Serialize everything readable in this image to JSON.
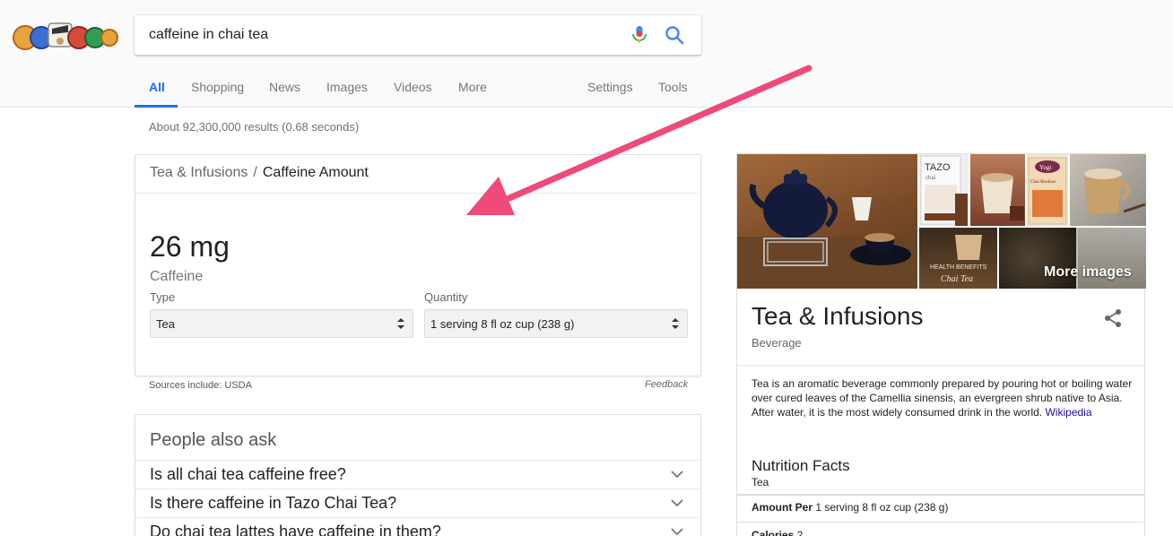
{
  "search": {
    "query": "caffeine in chai tea"
  },
  "tabs": [
    {
      "label": "All"
    },
    {
      "label": "Shopping"
    },
    {
      "label": "News"
    },
    {
      "label": "Images"
    },
    {
      "label": "Videos"
    },
    {
      "label": "More"
    },
    {
      "label": "Settings"
    },
    {
      "label": "Tools"
    }
  ],
  "results": {
    "count_text": "About 92,300,000 results (0.68 seconds)"
  },
  "featured": {
    "breadcrumb_category": "Tea & Infusions",
    "breadcrumb_separator": "/",
    "breadcrumb_current": "Caffeine Amount",
    "amount": "26 mg",
    "amount_label": "Caffeine",
    "type_label": "Type",
    "type_value": "Tea",
    "quantity_label": "Quantity",
    "quantity_value": "1 serving 8 fl oz cup (238 g)",
    "sources": "Sources include: USDA",
    "feedback": "Feedback"
  },
  "people_also_ask": {
    "title": "People also ask",
    "questions": [
      "Is all chai tea caffeine free?",
      "Is there caffeine in Tazo Chai Tea?",
      "Do chai tea lattes have caffeine in them?"
    ]
  },
  "knowledge_panel": {
    "more_images": "More images",
    "title": "Tea & Infusions",
    "subtitle": "Beverage",
    "description": "Tea is an aromatic beverage commonly prepared by pouring hot or boiling water over cured leaves of the Camellia sinensis, an evergreen shrub native to Asia. After water, it is the most widely consumed drink in the world.",
    "description_link": "Wikipedia",
    "image_texts": {
      "tazo": "TAZO",
      "tazo_sub": "chai",
      "yogi": "Yogi",
      "yogi_sub": "Chai Rooibos",
      "health": "HEALTH BENEFITS",
      "chai_tea": "Chai Tea"
    },
    "nutrition": {
      "title": "Nutrition Facts",
      "subtitle": "Tea",
      "amount_per_label": "Amount Per",
      "amount_per_value": "1 serving 8 fl oz cup (238 g)",
      "calories_label": "Calories",
      "calories_value": "2"
    }
  },
  "colors": {
    "accent_blue": "#1a73e8",
    "link": "#1a0dab",
    "annotation_arrow": "#ee4a7a"
  }
}
